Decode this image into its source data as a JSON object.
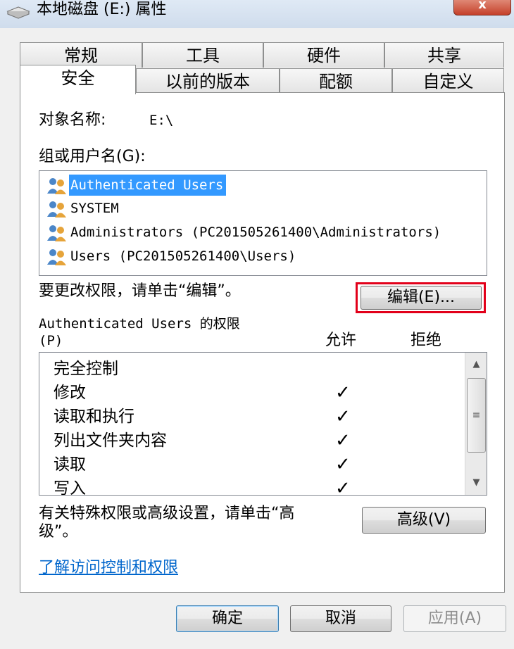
{
  "window": {
    "title": "本地磁盘 (E:) 属性",
    "close_label": "x"
  },
  "tabs_row1": [
    "常规",
    "工具",
    "硬件",
    "共享"
  ],
  "tabs_row2": [
    "安全",
    "以前的版本",
    "配额",
    "自定义"
  ],
  "object": {
    "label": "对象名称:",
    "value": "E:\\"
  },
  "groups": {
    "label": "组或用户名(G):",
    "users": [
      "Authenticated Users",
      "SYSTEM",
      "Administrators (PC201505261400\\Administrators)",
      "Users (PC201505261400\\Users)"
    ]
  },
  "change_hint": "要更改权限，请单击“编辑”。",
  "edit_button": "编辑(E)...",
  "permissions": {
    "title_line1": "Authenticated Users 的权限",
    "title_line2": "(P)",
    "allow_header": "允许",
    "deny_header": "拒绝",
    "rows": [
      {
        "name": "完全控制",
        "allow": ""
      },
      {
        "name": "修改",
        "allow": "✓"
      },
      {
        "name": "读取和执行",
        "allow": "✓"
      },
      {
        "name": "列出文件夹内容",
        "allow": "✓"
      },
      {
        "name": "读取",
        "allow": "✓"
      },
      {
        "name": "写入",
        "allow": "✓"
      }
    ]
  },
  "advanced_hint_line1": "有关特殊权限或高级设置，请单击“高",
  "advanced_hint_line2": "级”。",
  "advanced_button": "高级(V)",
  "learn_link": "了解访问控制和权限",
  "footer": {
    "ok": "确定",
    "cancel": "取消",
    "apply": "应用(A)"
  },
  "icons": {
    "title": "drive-icon",
    "user": "users-group-icon",
    "check": "checkmark-icon"
  }
}
